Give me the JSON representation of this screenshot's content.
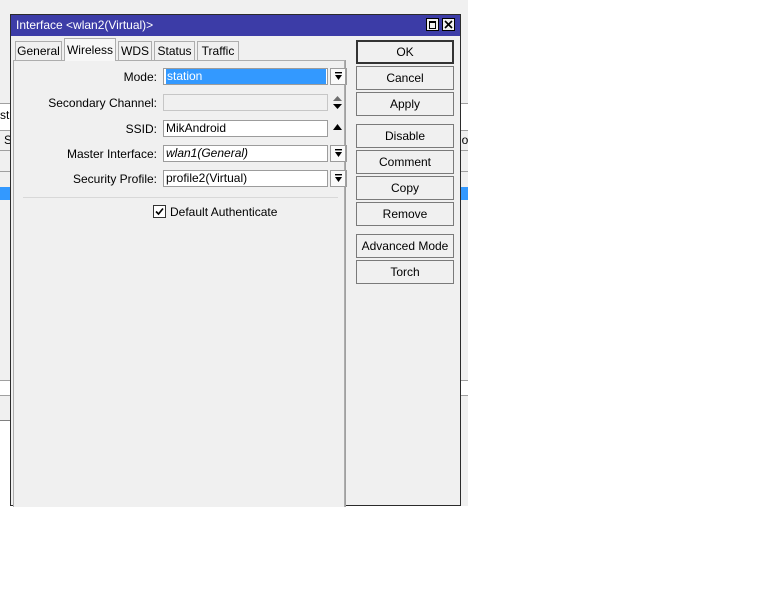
{
  "background": {
    "fragments": [
      "st",
      "S",
      "lo"
    ]
  },
  "dialog": {
    "title": "Interface <wlan2(Virtual)>",
    "tabs": [
      "General",
      "Wireless",
      "WDS",
      "Status",
      "Traffic"
    ],
    "active_tab": "Wireless",
    "fields": {
      "mode": {
        "label": "Mode:",
        "value": "station"
      },
      "secondary_channel": {
        "label": "Secondary Channel:",
        "value": ""
      },
      "ssid": {
        "label": "SSID:",
        "value": "MikAndroid"
      },
      "master_interface": {
        "label": "Master Interface:",
        "value": "wlan1(General)"
      },
      "security_profile": {
        "label": "Security Profile:",
        "value": "profile2(Virtual)"
      }
    },
    "default_authenticate": {
      "label": "Default Authenticate",
      "checked": true
    },
    "buttons": {
      "ok": "OK",
      "cancel": "Cancel",
      "apply": "Apply",
      "disable": "Disable",
      "comment": "Comment",
      "copy": "Copy",
      "remove": "Remove",
      "advanced_mode": "Advanced Mode",
      "torch": "Torch"
    }
  },
  "colors": {
    "titlebar": "#3c3ca7",
    "selection": "#3399ff"
  }
}
